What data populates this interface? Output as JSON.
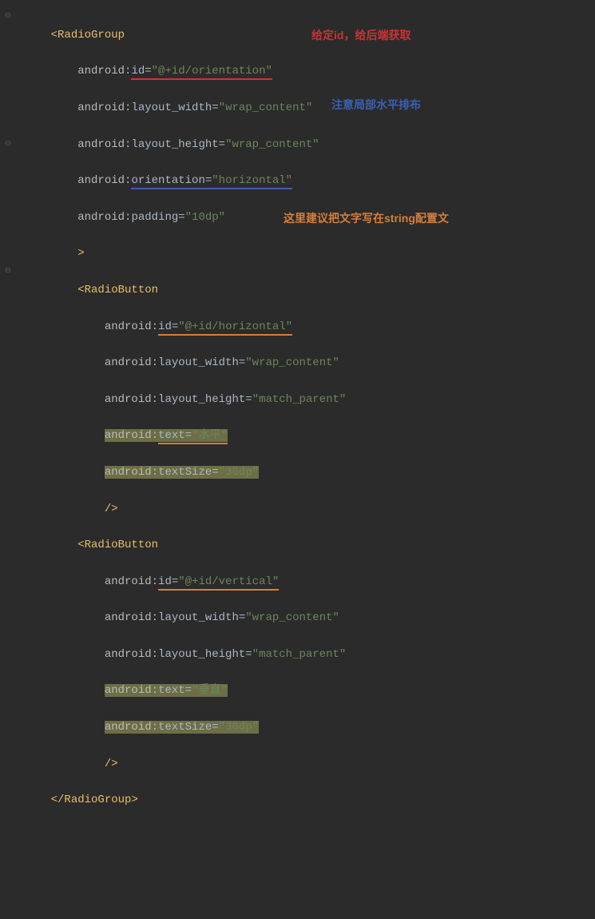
{
  "code": {
    "l1": {
      "tag": "RadioGroup"
    },
    "l2": {
      "ns": "android",
      "attr": "id",
      "val": "\"@+id/orientation\""
    },
    "l3": {
      "ns": "android",
      "attr": "layout_width",
      "val": "\"wrap_content\""
    },
    "l4": {
      "ns": "android",
      "attr": "layout_height",
      "val": "\"wrap_content\""
    },
    "l5": {
      "ns": "android",
      "attr": "orientation",
      "val": "\"horizontal\""
    },
    "l6": {
      "ns": "android",
      "attr": "padding",
      "val": "\"10dp\""
    },
    "l7": {
      "close": ">"
    },
    "l8": {
      "tag": "RadioButton"
    },
    "l9": {
      "ns": "android",
      "attr": "id",
      "val": "\"@+id/horizontal\""
    },
    "l10": {
      "ns": "android",
      "attr": "layout_width",
      "val": "\"wrap_content\""
    },
    "l11": {
      "ns": "android",
      "attr": "layout_height",
      "val": "\"match_parent\""
    },
    "l12": {
      "ns": "android",
      "attr": "text",
      "val": "\"水平\""
    },
    "l13": {
      "ns": "android",
      "attr": "textSize",
      "val": "\"30dp\""
    },
    "l14": {
      "close": "/>"
    },
    "l15": {
      "tag": "RadioButton"
    },
    "l16": {
      "ns": "android",
      "attr": "id",
      "val": "\"@+id/vertical\""
    },
    "l17": {
      "ns": "android",
      "attr": "layout_width",
      "val": "\"wrap_content\""
    },
    "l18": {
      "ns": "android",
      "attr": "layout_height",
      "val": "\"match_parent\""
    },
    "l19": {
      "ns": "android",
      "attr": "text",
      "val": "\"垂直\""
    },
    "l20": {
      "ns": "android",
      "attr": "textSize",
      "val": "\"30dp\""
    },
    "l21": {
      "close": "/>"
    },
    "l22": {
      "tag": "RadioGroup"
    }
  },
  "annotations": {
    "a1": "给定id，给后端获取",
    "a2": "注意局部水平排布",
    "a3": "这里建议把文字写在string配置文"
  }
}
